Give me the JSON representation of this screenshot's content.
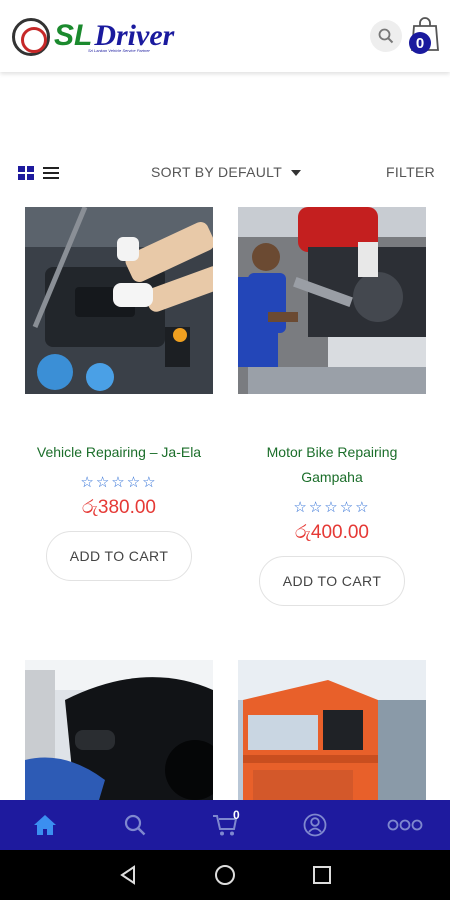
{
  "header": {
    "logo_sl": "SL",
    "logo_driver": "Driver",
    "logo_tagline": "Sri Lankan Vehicle Service Partner",
    "cart_count": "0"
  },
  "toolbar": {
    "sort_label": "SORT BY DEFAULT",
    "filter_label": "FILTER"
  },
  "products": [
    {
      "title": "Vehicle Repairing – Ja-Ela",
      "rating": 0,
      "price": "රු380.00",
      "button": "ADD TO CART"
    },
    {
      "title_line1": "Motor Bike Repairing",
      "title_line2": "Gampaha",
      "rating": 0,
      "price": "රු400.00",
      "button": "ADD TO CART"
    }
  ],
  "bottom_nav": {
    "cart_count": "0"
  },
  "colors": {
    "brand_blue": "#1e1a9e",
    "title_green": "#1b6e2a",
    "price_red": "#e53935",
    "star_blue": "#2f6fd6"
  }
}
